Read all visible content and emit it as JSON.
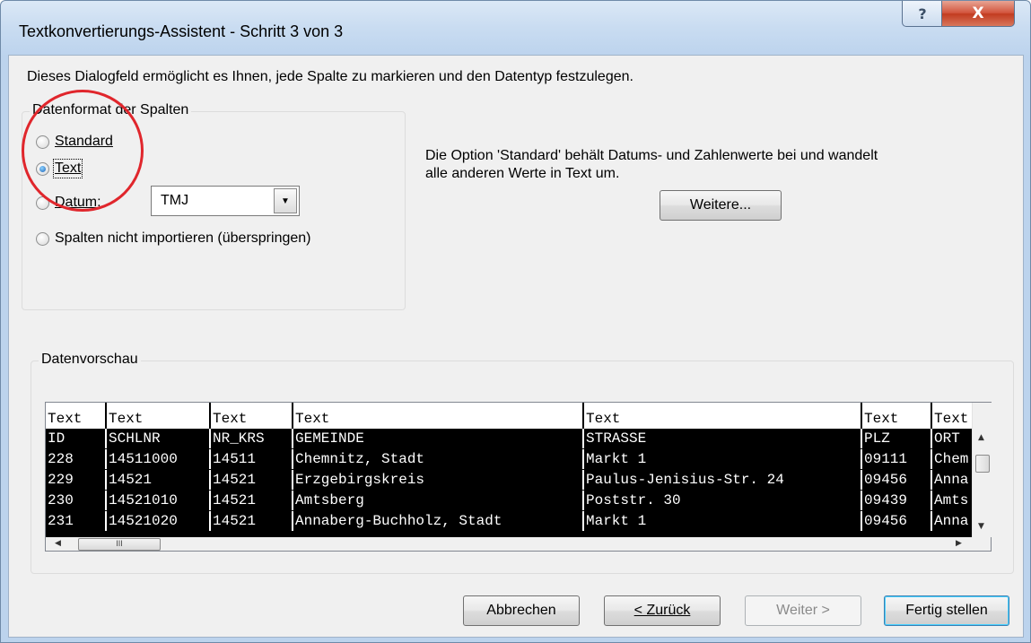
{
  "window": {
    "title": "Textkonvertierungs-Assistent - Schritt 3 von 3",
    "help_glyph": "?",
    "close_glyph": "X"
  },
  "intro_text": "Dieses Dialogfeld ermöglicht es Ihnen, jede Spalte zu markieren und den Datentyp festzulegen.",
  "format_group": {
    "legend": "Datenformat der Spalten",
    "options": [
      {
        "label": "Standard",
        "checked": false
      },
      {
        "label": "Text",
        "checked": true
      },
      {
        "label": "Datum:",
        "checked": false
      },
      {
        "label": "Spalten nicht importieren (überspringen)",
        "checked": false
      }
    ],
    "date_format": "TMJ"
  },
  "description": {
    "line1": "Die Option 'Standard' behält Datums- und Zahlenwerte bei und wandelt",
    "line2": "alle anderen Werte in Text um."
  },
  "advanced_button": "Weitere...",
  "preview": {
    "legend": "Datenvorschau",
    "headers": [
      "Text",
      "Text",
      "Text",
      "Text",
      "Text",
      "Text",
      "Text"
    ],
    "rows": [
      [
        "ID",
        "SCHLNR",
        "NR_KRS",
        "GEMEINDE",
        "STRASSE",
        "PLZ",
        "ORT"
      ],
      [
        "228",
        "14511000",
        "14511",
        "Chemnitz, Stadt",
        "Markt 1",
        "09111",
        "Chem"
      ],
      [
        "229",
        "14521",
        "14521",
        "Erzgebirgskreis",
        "Paulus-Jenisius-Str. 24",
        "09456",
        "Anna"
      ],
      [
        "230",
        "14521010",
        "14521",
        "Amtsberg",
        "Poststr. 30",
        "09439",
        "Amts"
      ],
      [
        "231",
        "14521020",
        "14521",
        "Annaberg-Buchholz, Stadt",
        "Markt 1",
        "09456",
        "Anna"
      ]
    ],
    "hthumb_grip": "III"
  },
  "buttons": {
    "cancel": "Abbrechen",
    "back": "< Zurück",
    "next": "Weiter >",
    "finish": "Fertig stellen"
  },
  "colors": {
    "annotation_circle": "#e0262c",
    "close_button": "#c23b20",
    "selected_column_bg": "#000000"
  }
}
